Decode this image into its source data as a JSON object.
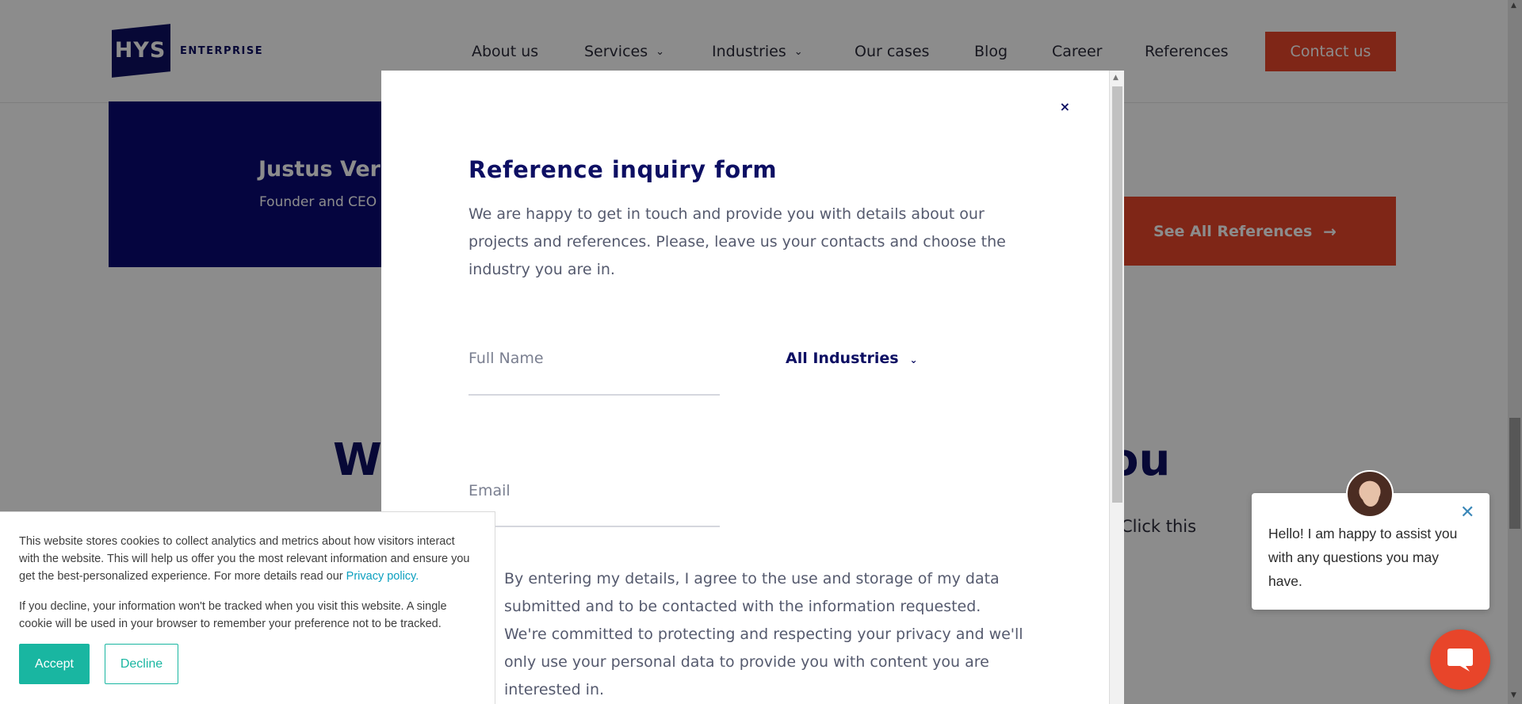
{
  "brand": {
    "logo_text": "HYS",
    "logo_word": "ENTERPRISE"
  },
  "nav": {
    "items": [
      {
        "label": "About us",
        "has_dropdown": false
      },
      {
        "label": "Services",
        "has_dropdown": true
      },
      {
        "label": "Industries",
        "has_dropdown": true
      },
      {
        "label": "Our cases",
        "has_dropdown": false
      },
      {
        "label": "Blog",
        "has_dropdown": false
      },
      {
        "label": "Career",
        "has_dropdown": false
      },
      {
        "label": "References",
        "has_dropdown": false
      }
    ],
    "contact_label": "Contact us"
  },
  "testimonial": {
    "name": "Justus Verk",
    "role": "Founder and CEO"
  },
  "references_button": {
    "label": "See All References",
    "arrow": "→"
  },
  "background_section": {
    "heading_left": "We",
    "heading_right": "ou",
    "text_fragment": "Click this"
  },
  "modal": {
    "close_glyph": "×",
    "title": "Reference inquiry form",
    "description": "We are happy to get in touch and provide you with details about our projects and references. Please, leave us your contacts and choose the industry you are in.",
    "full_name_placeholder": "Full Name",
    "email_placeholder": "Email",
    "industry_selected": "All Industries",
    "consent_text": "By entering my details, I agree to the use and storage of my data submitted and to be contacted with the information requested. We're committed to protecting and respecting your privacy and we'll only use your personal data to provide you with content you are interested in."
  },
  "cookie_banner": {
    "paragraph1": "This website stores cookies to collect analytics and metrics about how visitors interact with the website. This will help us offer you the most relevant information and ensure you get the best-personalized experience. For more details read our ",
    "privacy_link": "Privacy policy.",
    "paragraph2": "If you decline, your information won't be tracked when you visit this website. A single cookie will be used in your browser to remember your preference not to be tracked.",
    "accept_label": "Accept",
    "decline_label": "Decline"
  },
  "chat": {
    "message": "Hello! I am happy to assist you with any questions you may have.",
    "close_glyph": "✕"
  },
  "colors": {
    "brand_navy": "#0d0f63",
    "accent_orange": "#e8452a",
    "cookie_teal": "#19b6a1",
    "link_blue": "#0a9fbf"
  }
}
